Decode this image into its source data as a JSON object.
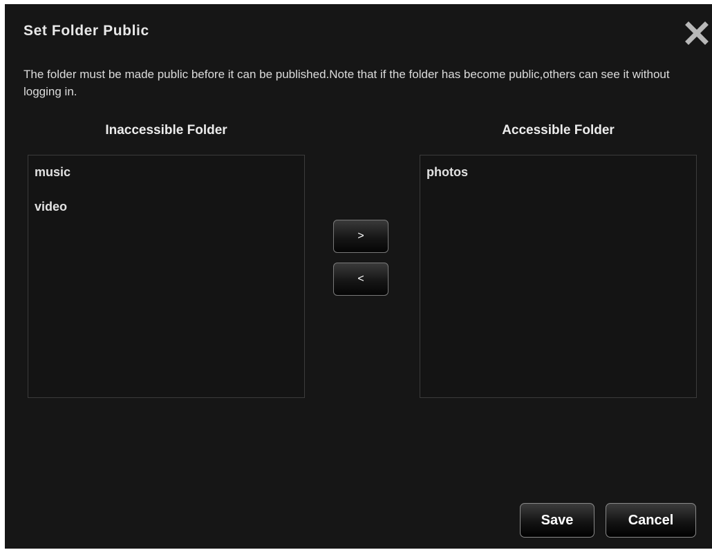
{
  "dialog": {
    "title": "Set Folder Public",
    "close_icon": "close-x-icon",
    "note": "The folder must be made public before it can be published.Note that if the folder has become public,others can see it without logging in."
  },
  "left_panel": {
    "header": "Inaccessible Folder",
    "items": [
      "music",
      "video"
    ]
  },
  "right_panel": {
    "header": "Accessible Folder",
    "items": [
      "photos"
    ]
  },
  "transfer": {
    "move_right_label": ">",
    "move_left_label": "<"
  },
  "footer": {
    "save_label": "Save",
    "cancel_label": "Cancel"
  },
  "colors": {
    "background": "#161616",
    "text": "#e6e6e6",
    "close_icon": "#b8b8b8"
  }
}
